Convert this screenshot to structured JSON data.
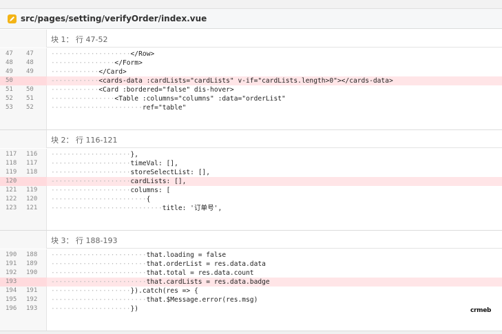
{
  "file": {
    "icon": "file-icon",
    "path": "src/pages/setting/verifyOrder/index.vue"
  },
  "blocks": [
    {
      "title": "块 1：  行 47-52",
      "lines": [
        {
          "old": "47",
          "new": "47",
          "indent": 20,
          "text": "</Row>",
          "type": "ctx"
        },
        {
          "old": "48",
          "new": "48",
          "indent": 16,
          "text": "</Form>",
          "type": "ctx"
        },
        {
          "old": "49",
          "new": "49",
          "indent": 12,
          "text": "</Card>",
          "type": "ctx"
        },
        {
          "old": "50",
          "new": "",
          "indent": 12,
          "text": "<cards-data :cardLists=\"cardLists\" v-if=\"cardLists.length>0\"></cards-data>",
          "type": "del"
        },
        {
          "old": "51",
          "new": "50",
          "indent": 12,
          "text": "<Card :bordered=\"false\" dis-hover>",
          "type": "ctx"
        },
        {
          "old": "52",
          "new": "51",
          "indent": 16,
          "text": "<Table :columns=\"columns\" :data=\"orderList\"",
          "type": "ctx"
        },
        {
          "old": "53",
          "new": "52",
          "indent": 23,
          "text": "ref=\"table\"",
          "type": "ctx"
        }
      ]
    },
    {
      "title": "块 2：  行 116-121",
      "lines": [
        {
          "old": "117",
          "new": "116",
          "indent": 20,
          "text": "},",
          "type": "ctx"
        },
        {
          "old": "118",
          "new": "117",
          "indent": 20,
          "text": "timeVal: [],",
          "type": "ctx"
        },
        {
          "old": "119",
          "new": "118",
          "indent": 20,
          "text": "storeSelectList: [],",
          "type": "ctx"
        },
        {
          "old": "120",
          "new": "",
          "indent": 20,
          "text": "cardLists: [],",
          "type": "del"
        },
        {
          "old": "121",
          "new": "119",
          "indent": 20,
          "text": "columns: [",
          "type": "ctx"
        },
        {
          "old": "122",
          "new": "120",
          "indent": 24,
          "text": "{",
          "type": "ctx"
        },
        {
          "old": "123",
          "new": "121",
          "indent": 28,
          "text": "title: '订单号',",
          "type": "ctx"
        }
      ]
    },
    {
      "title": "块 3：  行 188-193",
      "lines": [
        {
          "old": "190",
          "new": "188",
          "indent": 24,
          "text": "that.loading = false",
          "type": "ctx"
        },
        {
          "old": "191",
          "new": "189",
          "indent": 24,
          "text": "that.orderList = res.data.data",
          "type": "ctx"
        },
        {
          "old": "192",
          "new": "190",
          "indent": 24,
          "text": "that.total = res.data.count",
          "type": "ctx"
        },
        {
          "old": "193",
          "new": "",
          "indent": 24,
          "text": "that.cardLists = res.data.badge",
          "type": "del"
        },
        {
          "old": "194",
          "new": "191",
          "indent": 20,
          "text": "}).catch(res => {",
          "type": "ctx"
        },
        {
          "old": "195",
          "new": "192",
          "indent": 24,
          "text": "that.$Message.error(res.msg)",
          "type": "ctx"
        },
        {
          "old": "196",
          "new": "193",
          "indent": 20,
          "text": "})",
          "type": "ctx"
        }
      ]
    }
  ],
  "watermark": "crmeb",
  "colors": {
    "deleted_line_bg": "#ffe5e7",
    "file_icon": "#f3b417",
    "gutter_bg": "#f7f7f7"
  }
}
